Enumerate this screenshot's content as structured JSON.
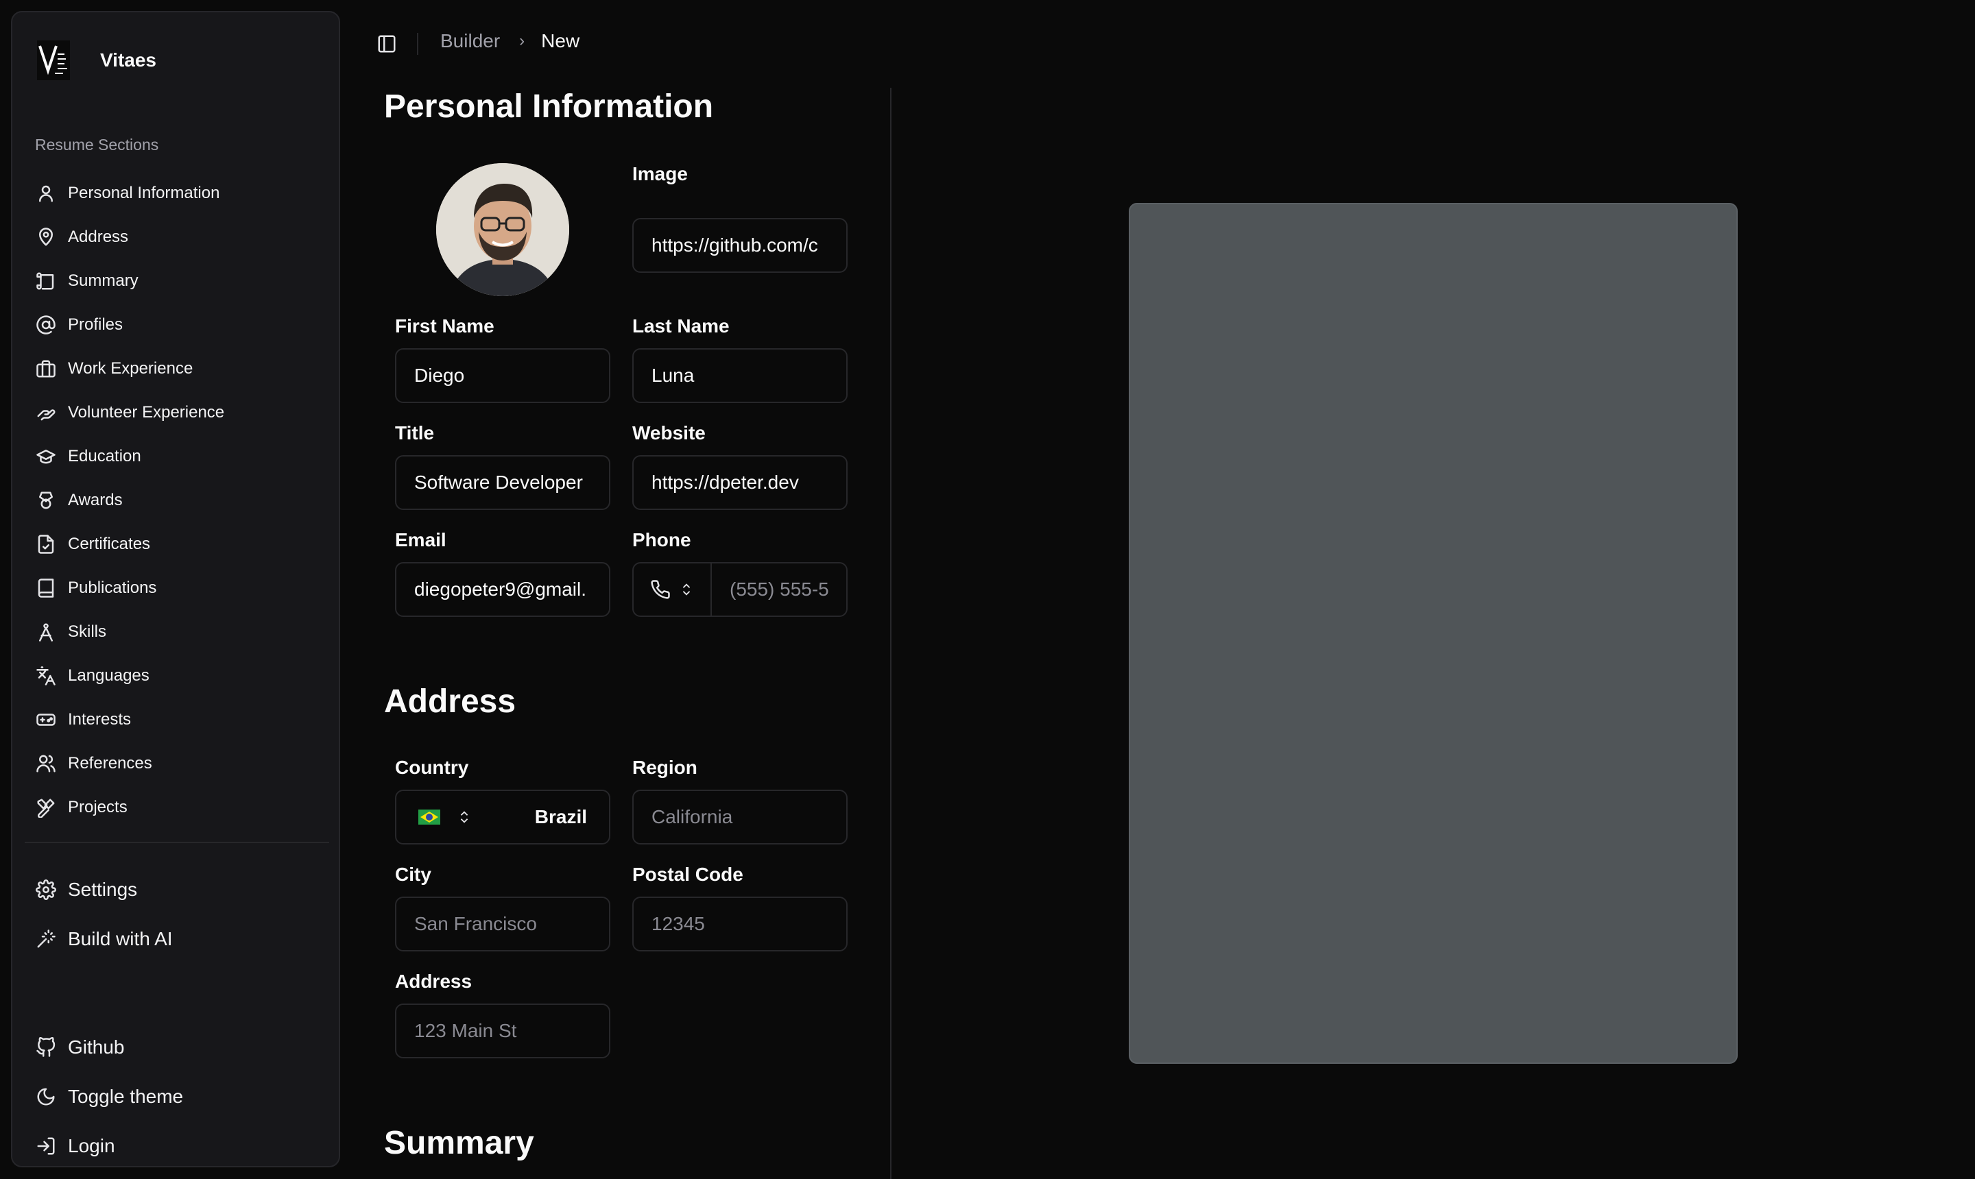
{
  "app": {
    "name": "Vitaes"
  },
  "breadcrumb": {
    "parent": "Builder",
    "current": "New"
  },
  "sidebar": {
    "group_label": "Resume Sections",
    "items": [
      {
        "label": "Personal Information",
        "icon": "user-icon"
      },
      {
        "label": "Address",
        "icon": "map-pin-icon"
      },
      {
        "label": "Summary",
        "icon": "scroll-icon"
      },
      {
        "label": "Profiles",
        "icon": "at-sign-icon"
      },
      {
        "label": "Work Experience",
        "icon": "briefcase-icon"
      },
      {
        "label": "Volunteer Experience",
        "icon": "hand-heart-icon"
      },
      {
        "label": "Education",
        "icon": "graduation-cap-icon"
      },
      {
        "label": "Awards",
        "icon": "award-icon"
      },
      {
        "label": "Certificates",
        "icon": "file-check-icon"
      },
      {
        "label": "Publications",
        "icon": "book-icon"
      },
      {
        "label": "Skills",
        "icon": "compass-icon"
      },
      {
        "label": "Languages",
        "icon": "languages-icon"
      },
      {
        "label": "Interests",
        "icon": "gamepad-icon"
      },
      {
        "label": "References",
        "icon": "users-icon"
      },
      {
        "label": "Projects",
        "icon": "tools-icon"
      }
    ],
    "tools": [
      {
        "label": "Settings",
        "icon": "gear-icon"
      },
      {
        "label": "Build with AI",
        "icon": "magic-wand-icon"
      }
    ],
    "footer": [
      {
        "label": "Github",
        "icon": "github-icon"
      },
      {
        "label": "Toggle theme",
        "icon": "moon-icon"
      },
      {
        "label": "Login",
        "icon": "login-icon"
      }
    ]
  },
  "personal": {
    "heading": "Personal Information",
    "image_label": "Image",
    "image_value": "https://github.com/c",
    "first_name_label": "First Name",
    "first_name": "Diego",
    "last_name_label": "Last Name",
    "last_name": "Luna",
    "title_label": "Title",
    "title": "Software Developer",
    "website_label": "Website",
    "website": "https://dpeter.dev",
    "email_label": "Email",
    "email": "diegopeter9@gmail.",
    "phone_label": "Phone",
    "phone_placeholder": "(555) 555-5"
  },
  "address": {
    "heading": "Address",
    "country_label": "Country",
    "country": "Brazil",
    "country_flag": "brazil-flag-icon",
    "region_label": "Region",
    "region_placeholder": "California",
    "city_label": "City",
    "city_placeholder": "San Francisco",
    "postal_label": "Postal Code",
    "postal_placeholder": "12345",
    "address_label": "Address",
    "address_placeholder": "123 Main St"
  },
  "summary": {
    "heading": "Summary"
  },
  "colors": {
    "background": "#0a0a0a",
    "sidebar": "#17171a",
    "border": "#27272a",
    "preview": "#505558"
  }
}
